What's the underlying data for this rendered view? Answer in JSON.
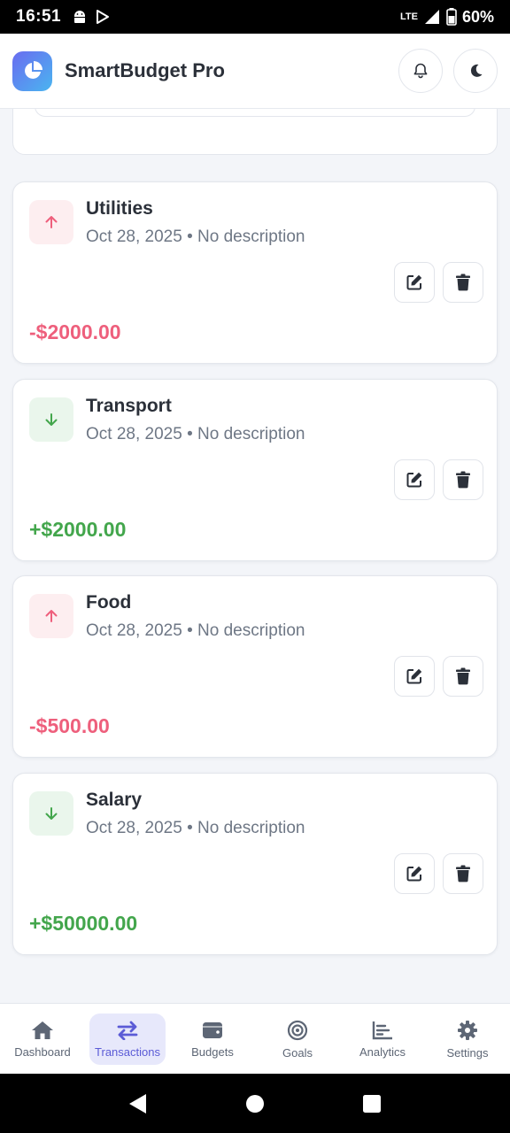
{
  "status_bar": {
    "time": "16:51",
    "network": "LTE",
    "battery": "60%"
  },
  "header": {
    "title": "SmartBudget Pro"
  },
  "transactions": [
    {
      "category": "Utilities",
      "date": "Oct 28, 2025",
      "separator": "•",
      "description": "No description",
      "amount": "-$2000.00",
      "type": "expense"
    },
    {
      "category": "Transport",
      "date": "Oct 28, 2025",
      "separator": "•",
      "description": "No description",
      "amount": "+$2000.00",
      "type": "income"
    },
    {
      "category": "Food",
      "date": "Oct 28, 2025",
      "separator": "•",
      "description": "No description",
      "amount": "-$500.00",
      "type": "expense"
    },
    {
      "category": "Salary",
      "date": "Oct 28, 2025",
      "separator": "•",
      "description": "No description",
      "amount": "+$50000.00",
      "type": "income"
    }
  ],
  "bottom_nav": [
    {
      "label": "Dashboard",
      "icon": "home-icon"
    },
    {
      "label": "Transactions",
      "icon": "swap-arrows-icon",
      "active": true
    },
    {
      "label": "Budgets",
      "icon": "wallet-icon"
    },
    {
      "label": "Goals",
      "icon": "target-icon"
    },
    {
      "label": "Analytics",
      "icon": "chart-icon"
    },
    {
      "label": "Settings",
      "icon": "gear-icon"
    }
  ],
  "colors": {
    "expense": "#ee5f7c",
    "income": "#43a64c",
    "accent": "#5b5bd6"
  }
}
